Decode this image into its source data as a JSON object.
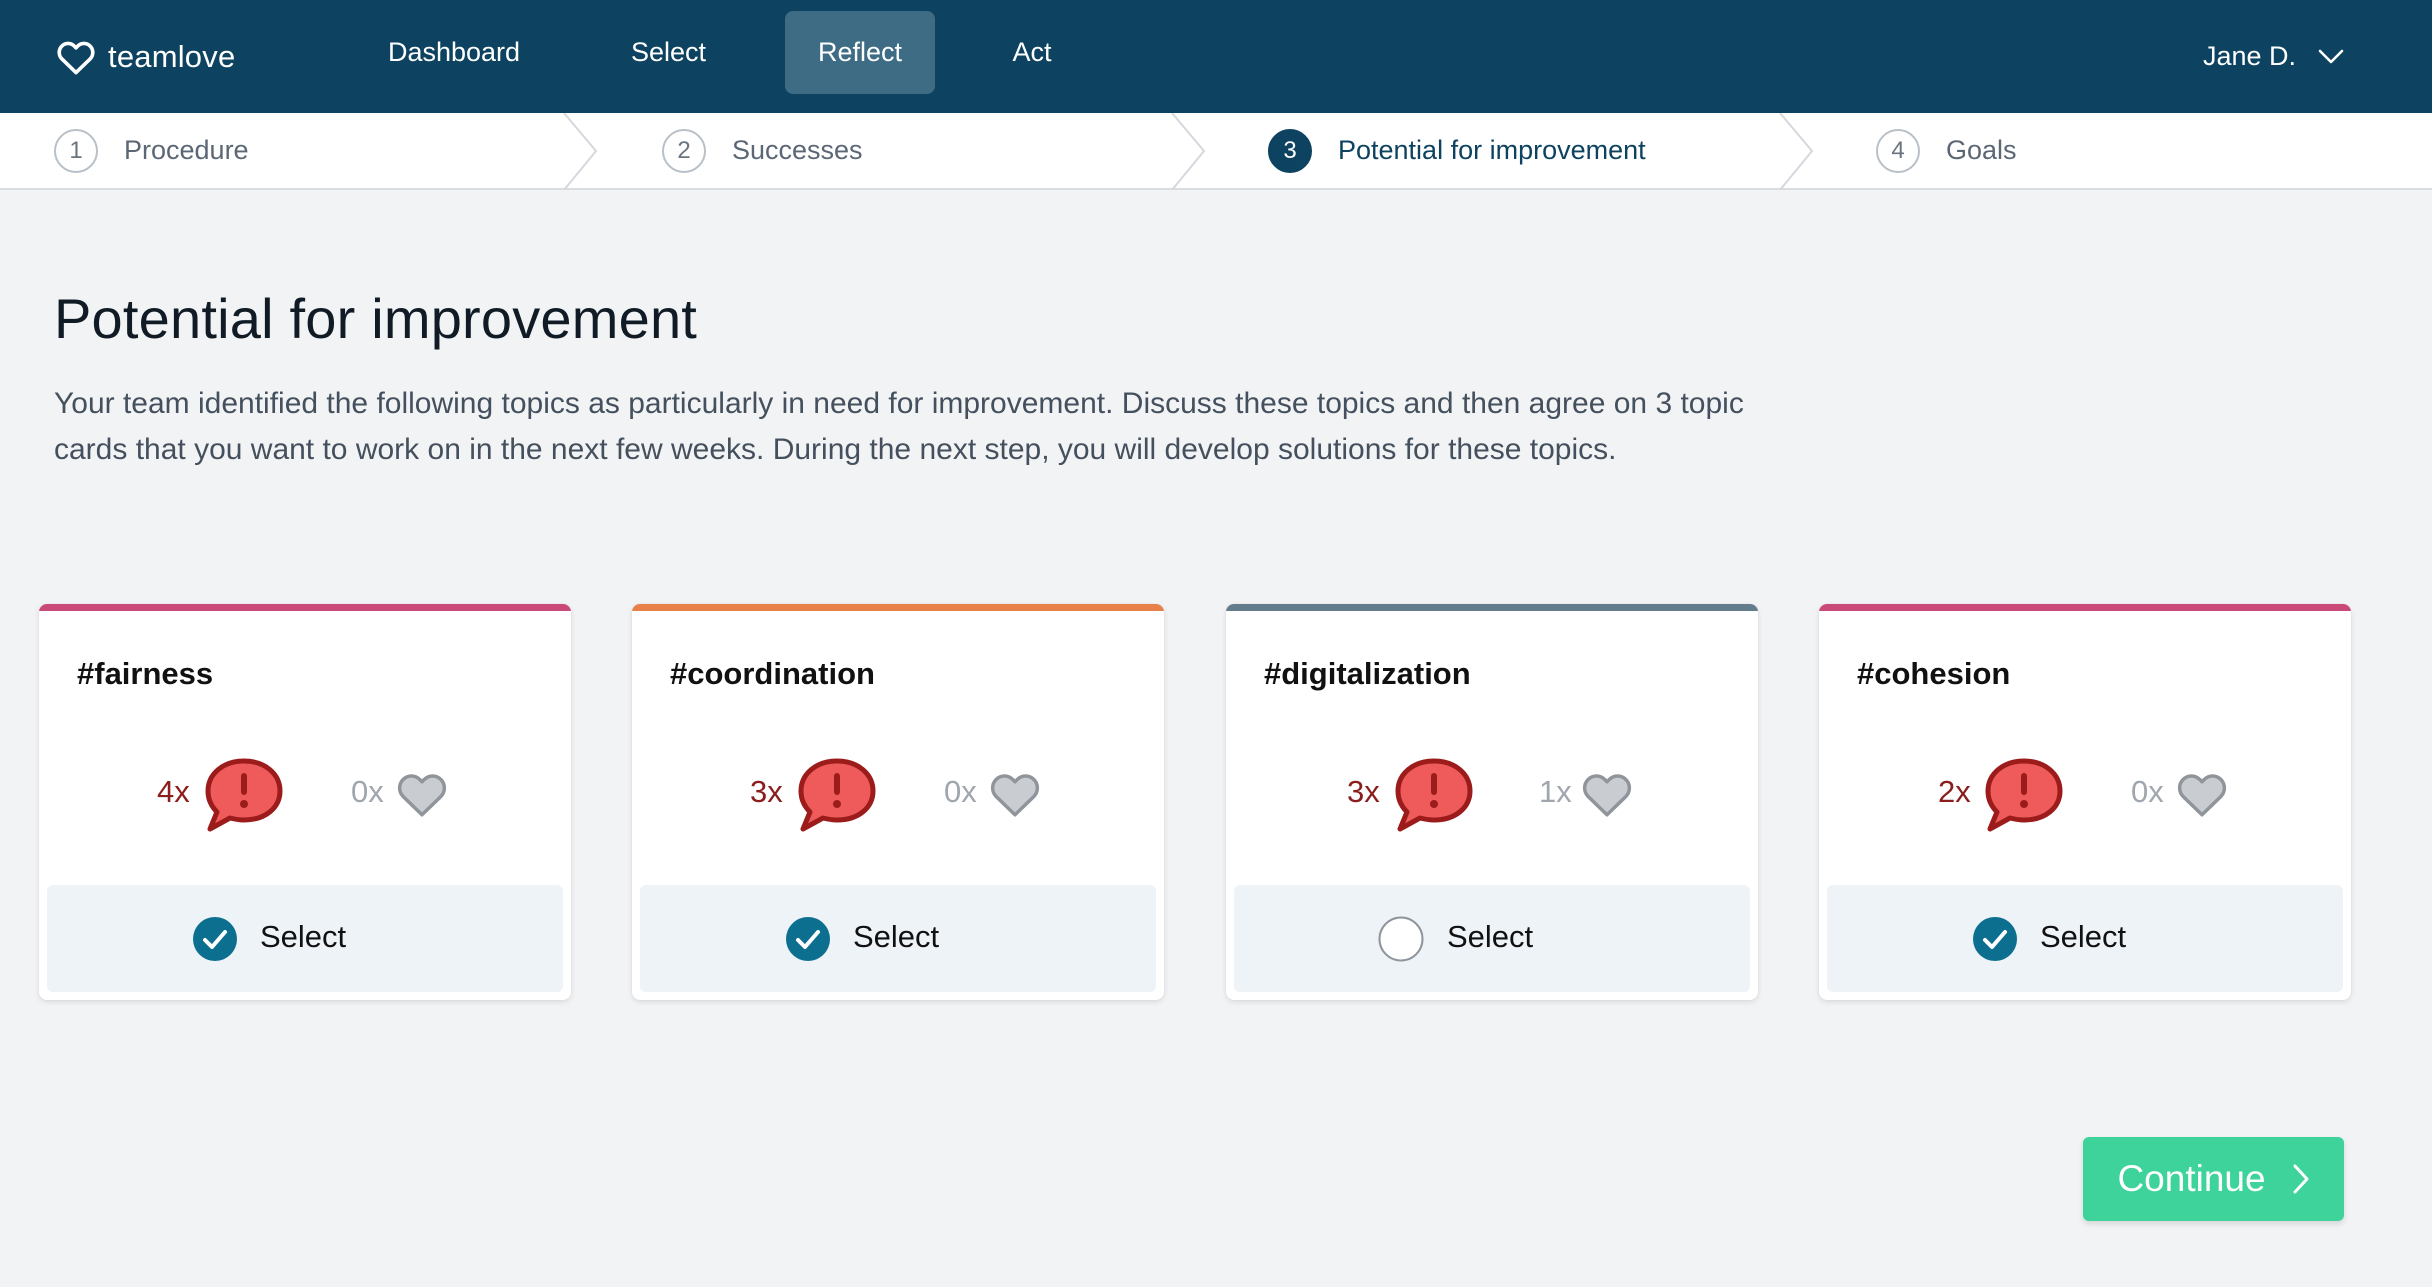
{
  "app": {
    "brand": "teamlove"
  },
  "nav": {
    "items": [
      {
        "label": "Dashboard"
      },
      {
        "label": "Select"
      },
      {
        "label": "Reflect",
        "active": true
      },
      {
        "label": "Act"
      }
    ],
    "user": "Jane D."
  },
  "stepper": {
    "steps": [
      {
        "num": "1",
        "label": "Procedure"
      },
      {
        "num": "2",
        "label": "Successes"
      },
      {
        "num": "3",
        "label": "Potential for improvement",
        "current": true
      },
      {
        "num": "4",
        "label": "Goals"
      }
    ]
  },
  "page": {
    "title": "Potential for improvement",
    "intro": "Your team identified the following topics as particularly in need for improvement. Discuss these topics and then agree on 3 topic cards that you want to work on in the next few weeks. During the next step, you will develop solutions for these topics."
  },
  "cards": [
    {
      "tag": "#fairness",
      "need_count": "4x",
      "love_count": "0x",
      "select_label": "Select",
      "selected": true,
      "accent": "#c94a79"
    },
    {
      "tag": "#coordination",
      "need_count": "3x",
      "love_count": "0x",
      "select_label": "Select",
      "selected": true,
      "accent": "#e8804a"
    },
    {
      "tag": "#digitalization",
      "need_count": "3x",
      "love_count": "1x",
      "select_label": "Select",
      "selected": false,
      "accent": "#637c8c"
    },
    {
      "tag": "#cohesion",
      "need_count": "2x",
      "love_count": "0x",
      "select_label": "Select",
      "selected": true,
      "accent": "#c94a79"
    }
  ],
  "actions": {
    "continue_label": "Continue"
  },
  "colors": {
    "nav_bg": "#0d4360",
    "nav_active": "#3d6c84",
    "primary": "#0d6f8f",
    "continue": "#3dd39a",
    "need": "#ef5b5b"
  }
}
